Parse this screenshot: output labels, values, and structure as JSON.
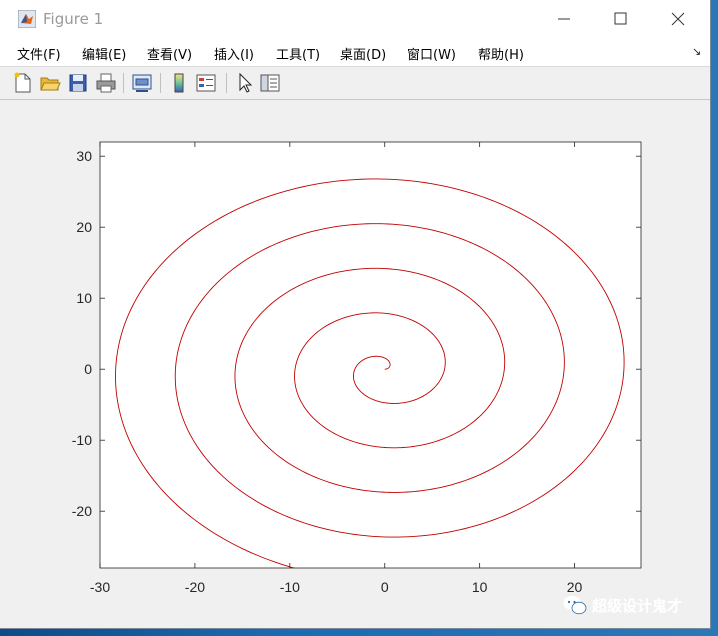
{
  "window": {
    "title": "Figure 1"
  },
  "menu": [
    "文件(F)",
    "编辑(E)",
    "查看(V)",
    "插入(I)",
    "工具(T)",
    "桌面(D)",
    "窗口(W)",
    "帮助(H)"
  ],
  "toolbar": {
    "icons": [
      "new-file-icon",
      "open-folder-icon",
      "save-icon",
      "print-icon",
      "link-plot-icon",
      "colorbar-icon",
      "legend-icon",
      "pointer-icon",
      "property-editor-icon"
    ]
  },
  "chart_data": {
    "type": "line",
    "title": "",
    "xlabel": "",
    "ylabel": "",
    "xlim": [
      -30,
      27
    ],
    "ylim": [
      -28,
      32
    ],
    "xticks": [
      -30,
      -20,
      -10,
      0,
      10,
      20
    ],
    "yticks": [
      -20,
      -10,
      0,
      10,
      20,
      30
    ],
    "grid": false,
    "series": [
      {
        "color": "#c00000",
        "shape": "archimedean-spiral",
        "center": [
          0,
          0
        ],
        "radius_per_turn": 6.3,
        "turns": 4.75
      }
    ]
  },
  "watermark": {
    "text": "超级设计鬼才"
  },
  "colors": {
    "accent": "#c00000",
    "titlebar": "#ffffff",
    "background": "#f0f0f0"
  }
}
